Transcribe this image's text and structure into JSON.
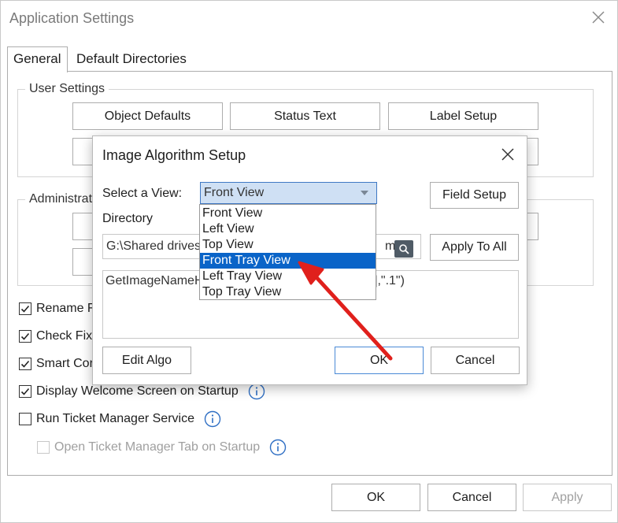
{
  "app": {
    "title": "Application Settings"
  },
  "tabs": [
    {
      "label": "General",
      "active": true
    },
    {
      "label": "Default Directories",
      "active": false
    }
  ],
  "user_settings": {
    "legend": "User Settings",
    "buttons": [
      "Object Defaults",
      "Status Text",
      "Label Setup"
    ]
  },
  "administration": {
    "legend": "Administrat"
  },
  "checkboxes": [
    {
      "label": "Rename F",
      "checked": true,
      "enabled": true
    },
    {
      "label": "Check Fixt",
      "checked": true,
      "enabled": true
    },
    {
      "label": "Smart Cor",
      "checked": true,
      "enabled": true
    },
    {
      "label": "Display Welcome Screen on Startup",
      "checked": true,
      "enabled": true,
      "info": true
    },
    {
      "label": "Run Ticket Manager Service",
      "checked": false,
      "enabled": true,
      "info": true
    },
    {
      "label": "Open Ticket Manager Tab on Startup",
      "checked": false,
      "enabled": false,
      "info": true
    }
  ],
  "footer": {
    "ok": "OK",
    "cancel": "Cancel",
    "apply": "Apply"
  },
  "dialog": {
    "title": "Image Algorithm Setup",
    "select_view_label": "Select a View:",
    "selected_view": "Front View",
    "field_setup": "Field Setup",
    "directory_label": "Directory",
    "directory_value": "G:\\Shared drives\\",
    "directory_tail": "ma",
    "apply_to_all": "Apply To All",
    "algorithm_text": "GetImageNameH",
    "algorithm_tail": "],\".1\")",
    "edit_algo": "Edit Algo",
    "ok": "OK",
    "cancel": "Cancel"
  },
  "view_options": [
    "Front View",
    "Left View",
    "Top View",
    "Front Tray View",
    "Left Tray View",
    "Top Tray View"
  ],
  "highlighted_option": "Front Tray View",
  "colors": {
    "accent": "#0a64c8",
    "combo_bg": "#cfe0f4",
    "annotation_arrow": "#e0201c"
  }
}
